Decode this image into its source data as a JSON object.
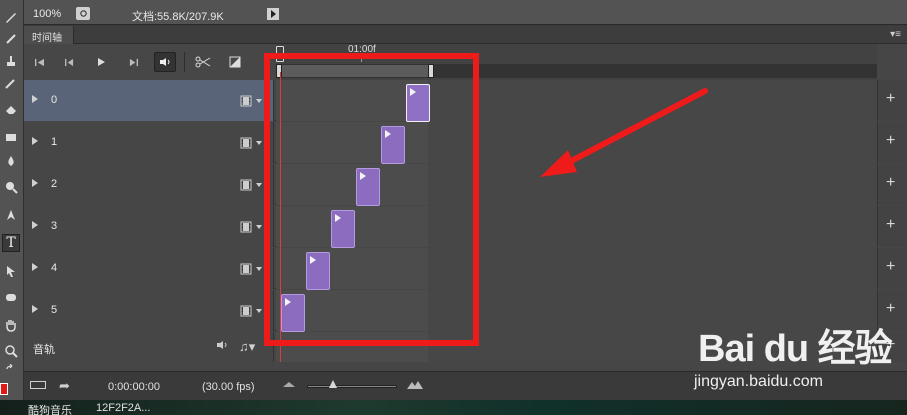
{
  "status_bar": {
    "zoom": "100%",
    "doc_info": "文档:55.8K/207.9K"
  },
  "panel": {
    "tab_label": "时间轴",
    "menu_icon": "panel-menu-icon"
  },
  "controls": {
    "icons": [
      "first-frame-icon",
      "prev-frame-icon",
      "play-icon",
      "next-frame-icon",
      "audio-icon",
      "split-icon",
      "transition-icon"
    ]
  },
  "ruler": {
    "time_label": "01:00f"
  },
  "layers": [
    {
      "label": "0",
      "clip_frame": 5
    },
    {
      "label": "1",
      "clip_frame": 4
    },
    {
      "label": "2",
      "clip_frame": 3
    },
    {
      "label": "3",
      "clip_frame": 2
    },
    {
      "label": "4",
      "clip_frame": 1
    },
    {
      "label": "5",
      "clip_frame": 0
    }
  ],
  "audio": {
    "label": "音轨"
  },
  "bottom_bar": {
    "timecode": "0:00:00:00",
    "fps": "(30.00 fps)"
  },
  "taskbar": {
    "items": [
      "酷狗音乐",
      "12F2F2A..."
    ]
  },
  "watermark": {
    "brand": "Bai du 经验",
    "url": "jingyan.baidu.com"
  },
  "colors": {
    "clip": "#8c6cbe",
    "selected_row": "#5a6478",
    "annotation": "#ef1a1a",
    "playhead": "#e03a3a"
  }
}
